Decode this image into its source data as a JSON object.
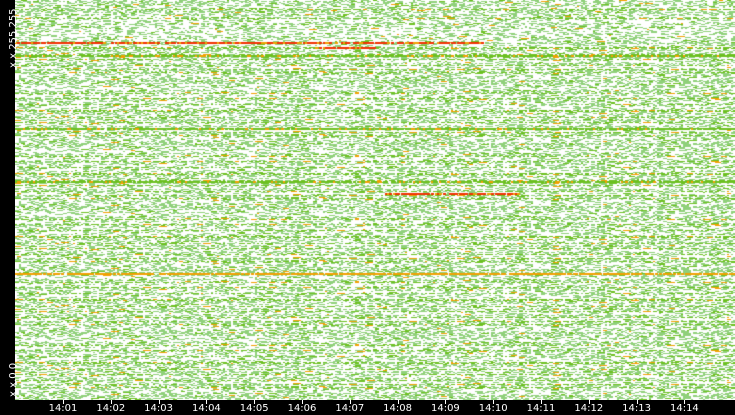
{
  "chart_data": {
    "type": "heatmap",
    "title": "",
    "ylabel_top": "x.x.255.255",
    "ylabel_bottom": "x.x.0.0",
    "x_ticks": [
      "14:01",
      "14:02",
      "14:03",
      "14:04",
      "14:05",
      "14:06",
      "14:07",
      "14:08",
      "14:09",
      "14:10",
      "14:11",
      "14:12",
      "14:13",
      "14:14"
    ],
    "colors": {
      "low": "#8fd07a",
      "mid": "#6cc020",
      "high": "#f0a000",
      "peak": "#f03000",
      "background": "#ffffff"
    }
  }
}
